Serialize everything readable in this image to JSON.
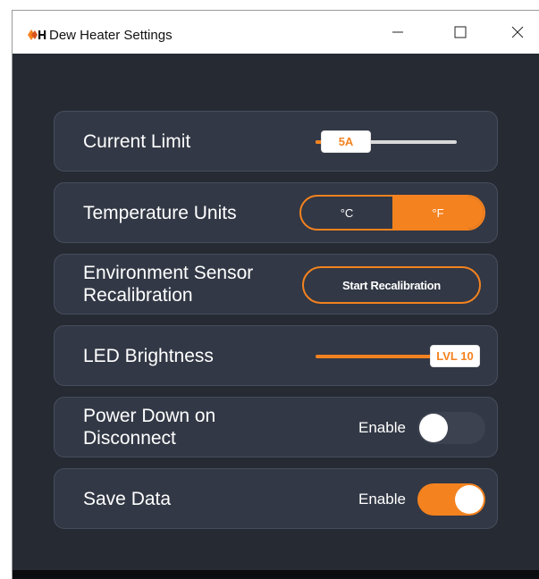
{
  "window": {
    "title": "Dew Heater Settings",
    "icon": "dew-heater-app-icon",
    "controls": [
      "minimize-icon",
      "maximize-icon",
      "close-icon"
    ]
  },
  "colors": {
    "accent": "#f4821f",
    "panel": "#252a33",
    "row": "#323845"
  },
  "settings": {
    "current_limit": {
      "label": "Current Limit",
      "value_label": "5A",
      "level": 0.04
    },
    "temperature_units": {
      "label": "Temperature Units",
      "options": [
        "°C",
        "°F"
      ],
      "selected": "°F"
    },
    "recalibration": {
      "label_line1": "Environment Sensor",
      "label_line2": "Recalibration",
      "button": "Start Recalibration"
    },
    "led_brightness": {
      "label": "LED Brightness",
      "value_label": "LVL 10",
      "level": 1.0
    },
    "power_down": {
      "label_line1": "Power Down on",
      "label_line2": "Disconnect",
      "enable_label": "Enable",
      "enabled": false
    },
    "save_data": {
      "label": "Save Data",
      "enable_label": "Enable",
      "enabled": true
    }
  }
}
